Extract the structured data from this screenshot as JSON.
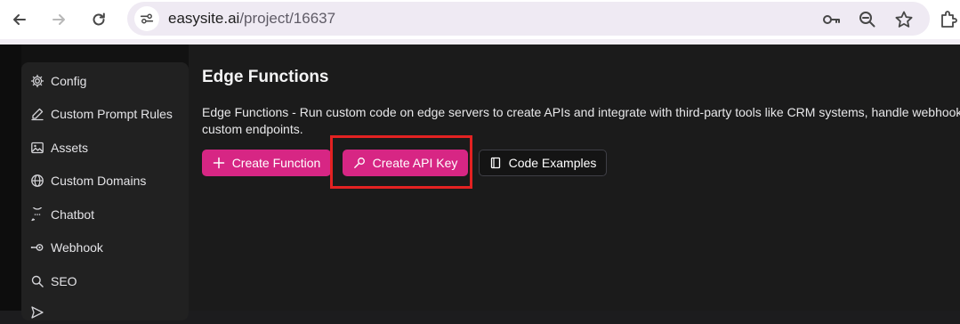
{
  "browser": {
    "url_host": "easysite.ai",
    "url_path": "/project/16637",
    "icons": [
      "back-arrow-icon",
      "forward-arrow-icon",
      "reload-icon",
      "site-settings-icon",
      "key-icon",
      "zoom-icon",
      "star-icon",
      "extensions-icon"
    ]
  },
  "sidebar": {
    "items": [
      {
        "label": "Config",
        "icon": "gear-icon"
      },
      {
        "label": "Custom Prompt Rules",
        "icon": "pencil-icon"
      },
      {
        "label": "Assets",
        "icon": "image-icon"
      },
      {
        "label": "Custom Domains",
        "icon": "globe-icon"
      },
      {
        "label": "Chatbot",
        "icon": "chat-icon"
      },
      {
        "label": "Webhook",
        "icon": "webhook-icon"
      },
      {
        "label": "SEO",
        "icon": "search-icon"
      }
    ]
  },
  "main": {
    "title": "Edge Functions",
    "description_line1": "Edge Functions - Run custom code on edge servers to create APIs and integrate with third-party tools like CRM systems, handle webhooks, sync",
    "description_line2": "custom endpoints.",
    "buttons": {
      "create_function": "Create Function",
      "create_api_key": "Create API Key",
      "code_examples": "Code Examples"
    }
  },
  "colors": {
    "accent": "#d72684",
    "highlight": "#e32222",
    "background": "#1b1b1b"
  }
}
